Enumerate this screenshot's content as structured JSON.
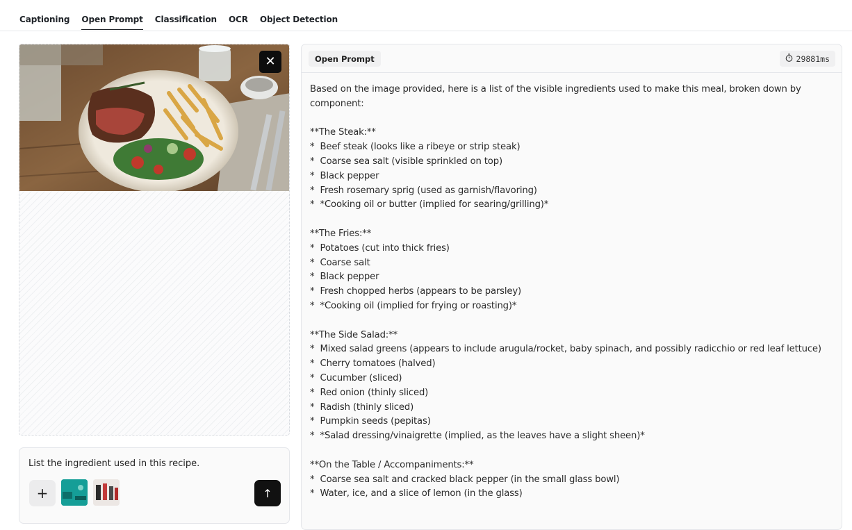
{
  "tabs": [
    {
      "label": "Captioning",
      "active": false
    },
    {
      "label": "Open Prompt",
      "active": true
    },
    {
      "label": "Classification",
      "active": false
    },
    {
      "label": "OCR",
      "active": false
    },
    {
      "label": "Object Detection",
      "active": false
    }
  ],
  "image_panel": {
    "close_icon": "close-icon",
    "close_glyph": "✕"
  },
  "prompt": {
    "text": "List the ingredient used in this recipe.",
    "add_glyph": "+",
    "send_glyph": "↑"
  },
  "output": {
    "mode_badge": "Open Prompt",
    "timing": "29881ms",
    "timer_icon": "timer-icon",
    "lines": [
      "Based on the image provided, here is a list of the visible ingredients used to make this meal, broken down by",
      "component:",
      "",
      "**The Steak:**",
      "*  Beef steak (looks like a ribeye or strip steak)",
      "*  Coarse sea salt (visible sprinkled on top)",
      "*  Black pepper",
      "*  Fresh rosemary sprig (used as garnish/flavoring)",
      "*  *Cooking oil or butter (implied for searing/grilling)*",
      "",
      "**The Fries:**",
      "*  Potatoes (cut into thick fries)",
      "*  Coarse salt",
      "*  Black pepper",
      "*  Fresh chopped herbs (appears to be parsley)",
      "*  *Cooking oil (implied for frying or roasting)*",
      "",
      "**The Side Salad:**",
      "*  Mixed salad greens (appears to include arugula/rocket, baby spinach, and possibly radicchio or red leaf lettuce)",
      "*  Cherry tomatoes (halved)",
      "*  Cucumber (sliced)",
      "*  Red onion (thinly sliced)",
      "*  Radish (thinly sliced)",
      "*  Pumpkin seeds (pepitas)",
      "*  *Salad dressing/vinaigrette (implied, as the leaves have a slight sheen)*",
      "",
      "**On the Table / Accompaniments:**",
      "*  Coarse sea salt and cracked black pepper (in the small glass bowl)",
      "*  Water, ice, and a slice of lemon (in the glass)"
    ]
  }
}
